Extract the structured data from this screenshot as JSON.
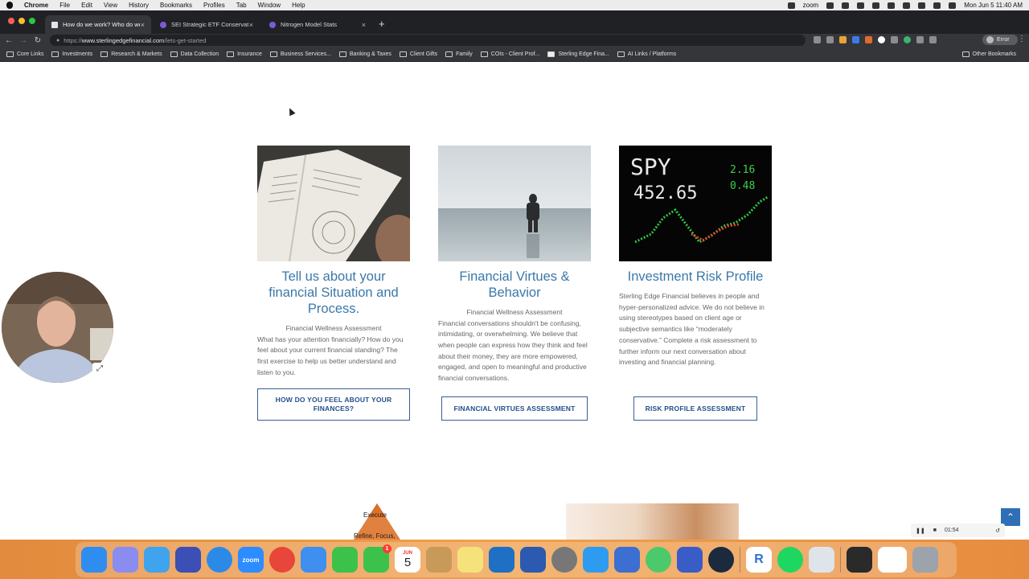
{
  "menubar": {
    "app": "Chrome",
    "items": [
      "File",
      "Edit",
      "View",
      "History",
      "Bookmarks",
      "Profiles",
      "Tab",
      "Window",
      "Help"
    ],
    "zoom": "zoom",
    "datetime": "Mon Jun 5  11:40 AM"
  },
  "tabs": [
    {
      "title": "How do we work? Who do we",
      "close": "×"
    },
    {
      "title": "SEI Strategic ETF Conservative",
      "close": "×"
    },
    {
      "title": "Nitrogen Model Stats",
      "close": "×"
    }
  ],
  "new_tab": "+",
  "omnibox": {
    "scheme": "https://",
    "host": "www.sterlingedgefinancial.com",
    "path": "/lets-get-started"
  },
  "profile": {
    "label": "Error"
  },
  "bookmarks": [
    "Core Links",
    "Investments",
    "Research & Markets",
    "Data Collection",
    "Insurance",
    "Business Services...",
    "Banking & Taxes",
    "Client Gifts",
    "Family",
    "COIs - Client Prof...",
    "Sterling Edge Fina...",
    "AI Links / Platforms"
  ],
  "bookmarks_other": "Other Bookmarks",
  "cards": [
    {
      "title": "Tell us about your financial Situation and Process.",
      "subtitle": "Financial Wellness Assessment",
      "body": "What has your attention financially? How do you feel about your current financial standing? The first exercise to help us better understand and listen to you.",
      "button": "HOW DO YOU FEEL ABOUT YOUR FINANCES?"
    },
    {
      "title": "Financial Virtues & Behavior",
      "subtitle": "Financial Wellness Assessment",
      "body": "Financial conversations shouldn't be confusing, intimidating, or overwhelming.  We believe that when people can express how they think and feel about their money, they are more empowered, engaged, and open to meaningful and productive financial conversations.",
      "button": "FINANCIAL VIRTUES ASSESSMENT"
    },
    {
      "title": "Investment Risk Profile",
      "subtitle": "",
      "body": "Sterling Edge Financial believes in people and hyper-personalized advice.  We do not believe in using stereotypes based on client age or subjective semantics like “moderately conservative.”  Complete a risk assessment to further inform our next conversation about investing and financial planning.",
      "button": "RISK PROFILE ASSESSMENT"
    }
  ],
  "ticker_image": {
    "symbol": "SPY",
    "price": "452.65",
    "change": "2.16",
    "pct": "0.48"
  },
  "pyramid": {
    "top": "Execute",
    "second": "Refine, Focus,"
  },
  "recorder": {
    "time": "01:54"
  },
  "dock": {
    "calendar_month": "JUN",
    "calendar_day": "5",
    "facetime_badge": "1"
  },
  "colors": {
    "title_blue": "#3a78a9",
    "button_blue": "#23508c",
    "chrome_dark": "#202124"
  }
}
